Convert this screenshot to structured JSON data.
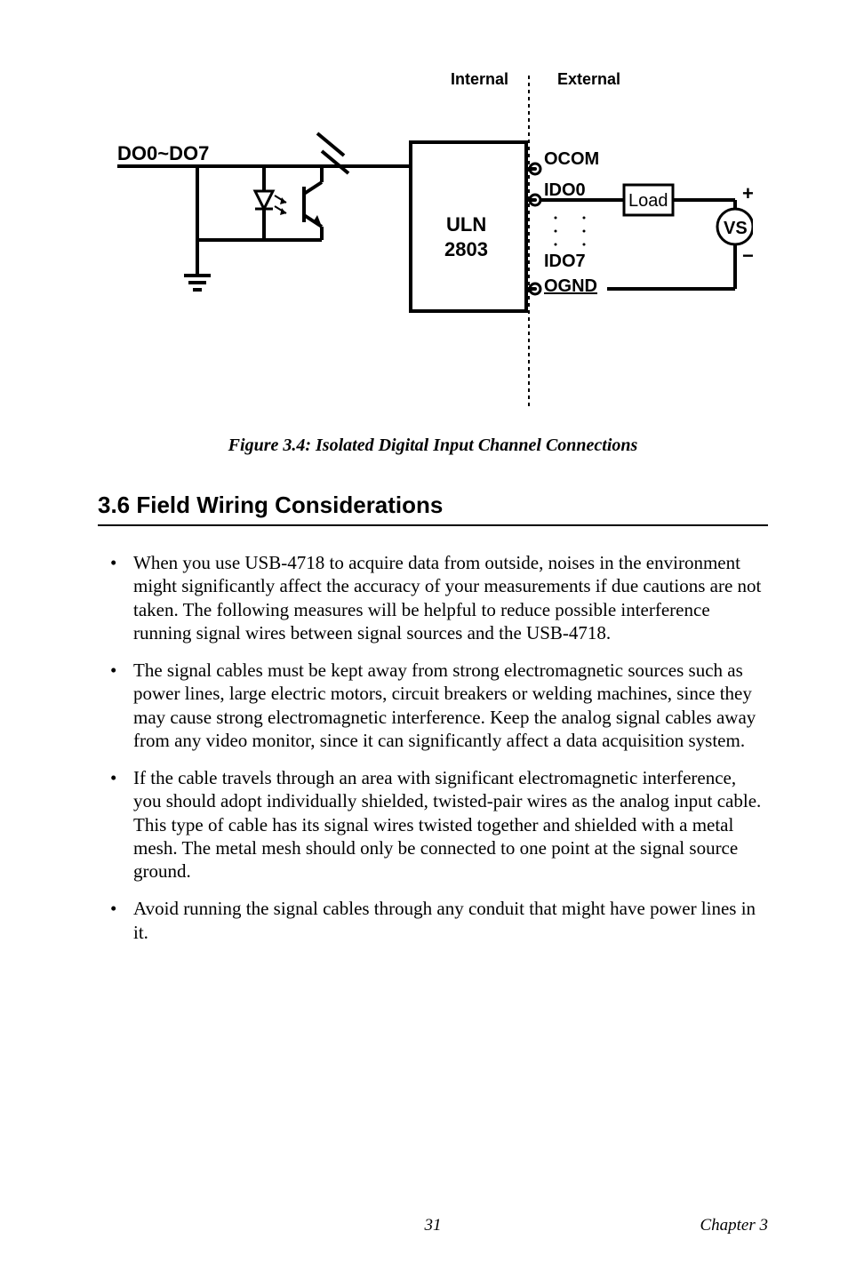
{
  "figure": {
    "caption": "Figure 3.4: Isolated Digital Input Channel Connections",
    "labels": {
      "internal": "Internal",
      "external": "External",
      "do": "DO0~DO7",
      "uln": "ULN",
      "uln2": "2803",
      "ocom": "OCOM",
      "ido0": "IDO0",
      "ido7": "IDO7",
      "ognd": "OGND",
      "load": "Load",
      "vs": "VS",
      "plus": "+",
      "minus": "−"
    }
  },
  "section": {
    "number_title": "3.6  Field Wiring Considerations"
  },
  "bullets": [
    "When you use USB-4718 to acquire data from outside, noises in the environment might significantly affect the accuracy of your measurements if due cautions are not taken. The following measures will be helpful to reduce possible interference running signal wires between signal sources and the USB-4718.",
    "The signal cables must be kept away from strong electromagnetic sources such as power lines, large electric motors, circuit breakers or welding machines, since they may cause strong electromagnetic interference. Keep the analog signal cables away from any video monitor, since it can significantly affect a data acquisition system.",
    "If the cable travels through an area with significant electromagnetic interference, you should adopt individually shielded, twisted-pair wires as the analog input cable. This type of cable has its signal wires twisted together and shielded with a metal mesh. The metal mesh should only be connected to one point at the signal source ground.",
    "Avoid running the signal cables through any conduit that might have power lines in it."
  ],
  "footer": {
    "page": "31",
    "chapter": "Chapter 3"
  }
}
